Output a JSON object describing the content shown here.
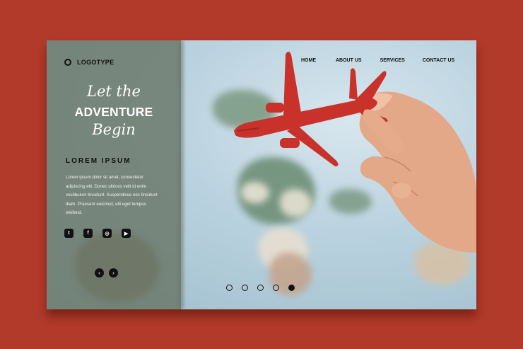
{
  "header": {
    "logo_text": "LOGOTYPE",
    "nav": [
      "HOME",
      "ABOUT US",
      "SERVICES",
      "CONTACT US"
    ]
  },
  "hero": {
    "line1": "Let the",
    "line2": "ADVENTURE",
    "line3": "Begin",
    "subtitle": "LOREM IPSUM",
    "body": "Lorem ipsum dolor sit amet, consectetur adipiscing elit. Donec ultrices velit id enim vestibulum tincidunt. Suspendisse nec tincidunt diam. Praesent euismod, elit eget tempus eleifend."
  },
  "social": [
    {
      "icon": "twitter-icon",
      "glyph": "t"
    },
    {
      "icon": "facebook-icon",
      "glyph": "f"
    },
    {
      "icon": "instagram-icon",
      "glyph": "◎"
    },
    {
      "icon": "youtube-icon",
      "glyph": "▶"
    }
  ],
  "slider": {
    "prev_glyph": "‹",
    "next_glyph": "›",
    "dot_count": 5,
    "active_dot": 5
  },
  "colors": {
    "background": "#b23a2a",
    "panel": "#69766a",
    "plane": "#c8322a"
  }
}
